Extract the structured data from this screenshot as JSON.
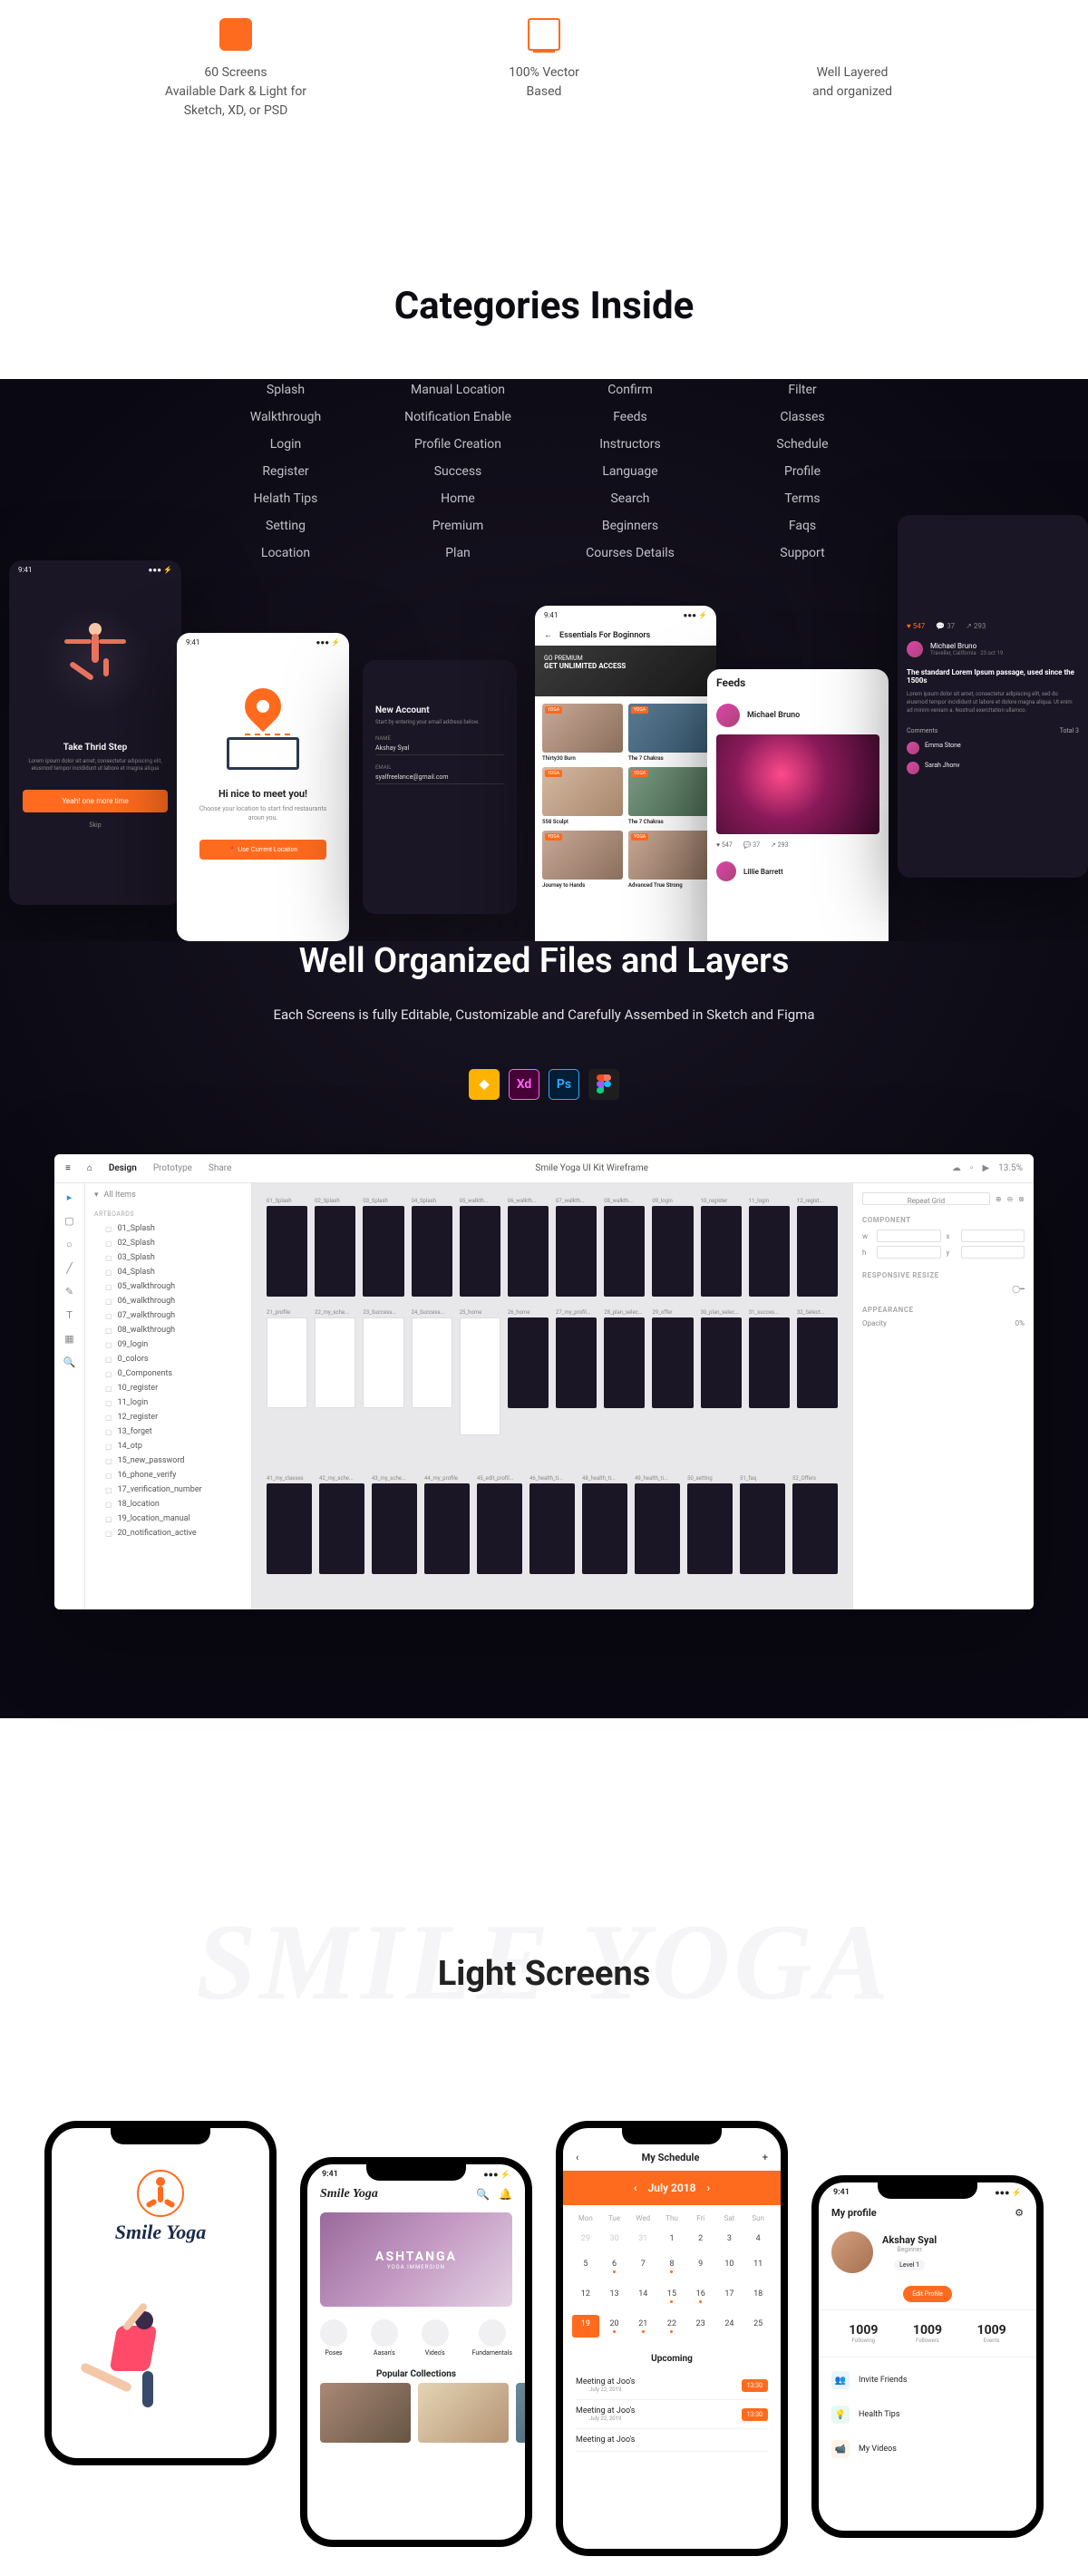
{
  "features": [
    {
      "title": "60 Screens\nAvailable Dark & Light for\nSketch, XD, or PSD"
    },
    {
      "title": "100% Vector\nBased"
    },
    {
      "title": "Well Layered\nand organized"
    }
  ],
  "categories_title": "Categories Inside",
  "categories": [
    "Splash",
    "Manual Location",
    "Confirm",
    "Filter",
    "Walkthrough",
    "Notification Enable",
    "Feeds",
    "Classes",
    "Login",
    "Profile Creation",
    "Instructors",
    "Schedule",
    "Register",
    "Success",
    "Language",
    "Profile",
    "Helath Tips",
    "Home",
    "Search",
    "Terms",
    "Setting",
    "Premium",
    "Beginners",
    "Faqs",
    "Location",
    "Plan",
    "Courses Details",
    "Support"
  ],
  "phones": {
    "ph1_status_time": "9:41",
    "ph1_title": "Take Thrid Step",
    "ph1_desc": "Lorem ipsum dolor sit amet, consectetur adipiscing elit, eiusmod tempor incididunt ut labore et magna aliqua",
    "ph1_btn": "Yeah! one more time",
    "ph1_skip": "Skip",
    "ph2_status_time": "9:41",
    "ph2_title": "Hi nice to meet you!",
    "ph2_desc": "Choose your location to start find restaurants aroun you.",
    "ph2_btn": "📍 Use Current Location",
    "ph3_title": "New Account",
    "ph3_desc": "Start by entering your email address below.",
    "ph3_field1_label": "NAME",
    "ph3_field1_val": "Akshay Syal",
    "ph3_field2_label": "EMAIL",
    "ph3_field2_val": "syalfreelance@gmail.com",
    "ph4_status_time": "9:41",
    "ph4_title": "Essentials For Boginnors",
    "ph4_hero1": "GO PREMIUM",
    "ph4_hero2": "GET UNLIMITED ACCESS",
    "ph4_cards": [
      "Thirty30 Burn",
      "The 7 Chakras",
      "558 Sculpt",
      "The 7 Chakras",
      "Journey to Hands",
      "Advanced True Strong"
    ],
    "ph5_title": "Feeds",
    "ph5_user": "Michael Bruno",
    "ph5_likes": "547",
    "ph5_comments": "37",
    "ph5_shares": "293",
    "ph5_user2": "Lillie Barrett",
    "ph6_likes": "547",
    "ph6_comments": "37",
    "ph6_shares": "293",
    "ph6_user": "Michael Bruno",
    "ph6_usersub": "Traveller, California · 23 oct 19",
    "ph6_headline": "The standard Lorem Ipsum passage, used since the 1500s",
    "ph6_lorem": "Lorem ipsum dolor sit amet, consectetur adipiscing elit, sed do eiusmod tempor incididunt ut labore et dolore magna aliqua. Ut enim ad minim veniam a. Nostrud exercitation ullamco.",
    "ph6_comments_label": "Comments",
    "ph6_total": "Total 3",
    "ph6_c1": "Emma Stone",
    "ph6_c2": "Sarah Jhonv"
  },
  "well_org": {
    "title": "Well Organized Files and Layers",
    "desc": "Each Screens is fully Editable, Customizable and Carefully Assembed in Sketch and Figma"
  },
  "design_tool": {
    "tabs": [
      "Design",
      "Prototype",
      "Share"
    ],
    "title": "Smile Yoga UI Kit Wireframe",
    "zoom": "13.5%",
    "layers_head": "All Items",
    "artboard_group": "ARTBOARDS",
    "layers": [
      "01_Splash",
      "02_Splash",
      "03_Splash",
      "04_Splash",
      "05_walkthrough",
      "06_walkthrough",
      "07_walkthrough",
      "08_walkthrough",
      "09_login",
      "0_colors",
      "0_Components",
      "10_register",
      "11_login",
      "12_register",
      "13_forget",
      "14_otp",
      "15_new_password",
      "16_phone_verify",
      "17_verification_number",
      "18_location",
      "19_location_manual",
      "20_notification_active"
    ],
    "canvas_labels_r1": [
      "01_Splash",
      "02_Splash",
      "03_Splash",
      "04_Splash",
      "05_walkth...",
      "06_walkth...",
      "07_walkth...",
      "08_walkth...",
      "09_login",
      "10_register",
      "11_login",
      "12_regist..."
    ],
    "canvas_labels_r2": [
      "21_profile",
      "22_my_sche...",
      "23_Success...",
      "24_Success...",
      "25_home",
      "26_home",
      "27_my_profil...",
      "28_plan_selec...",
      "29_offer",
      "30_plan_selec...",
      "31_succes...",
      "32_Select..."
    ],
    "canvas_labels_r3": [
      "41_my_classes",
      "42_my_sche...",
      "43_my_sche...",
      "44_my_profile",
      "45_edit_profil...",
      "46_health_ti...",
      "48_health_ti...",
      "49_health_ti...",
      "50_setting",
      "51_faq",
      "52_Offers"
    ],
    "panel_component": "COMPONENT",
    "panel_responsive": "RESPONSIVE RESIZE",
    "panel_appearance": "APPEARANCE",
    "repeat_grid": "Repeat Grid",
    "opacity": "0%"
  },
  "light_section": {
    "ghost": "SMILE YOGA",
    "title": "Light Screens"
  },
  "device1": {
    "brand": "Smile Yoga"
  },
  "device2": {
    "time": "9:41",
    "brand": "Smile Yoga",
    "hero_title": "ASHTANGA",
    "hero_sub": "YOGA IMMERSION",
    "pills": [
      "Poses",
      "Aasan's",
      "Video's",
      "Fundamentals"
    ],
    "sec_title": "Popular Collections"
  },
  "device3": {
    "head": "My Schedule",
    "month": "July 2018",
    "weekdays": [
      "Mon",
      "Tue",
      "Wed",
      "Thu",
      "Fri",
      "Sat",
      "Sun"
    ],
    "days": [
      [
        29,
        30,
        31,
        1,
        2,
        3,
        4
      ],
      [
        5,
        6,
        7,
        8,
        9,
        10,
        11
      ],
      [
        12,
        13,
        14,
        15,
        16,
        17,
        18
      ],
      [
        19,
        20,
        21,
        22,
        23,
        24,
        25
      ]
    ],
    "upcoming": "Upcoming",
    "events": [
      {
        "title": "Meeting at Joo's",
        "sub": "July 22, 2019",
        "time": "13:30"
      },
      {
        "title": "Meeting at Joo's",
        "sub": "July 22, 2019",
        "time": "13:30"
      },
      {
        "title": "Meeting at Joo's",
        "sub": "",
        "time": ""
      }
    ]
  },
  "device4": {
    "time": "9:41",
    "head": "My profile",
    "name": "Akshay Syal",
    "role": "Beginner",
    "level": "Level 1",
    "edit": "Edit Profile",
    "stats": [
      {
        "n": "1009",
        "l": "Following"
      },
      {
        "n": "1009",
        "l": "Followers"
      },
      {
        "n": "1009",
        "l": "Events"
      }
    ],
    "menu": [
      "Invite Friends",
      "Health Tips",
      "My Videos"
    ]
  }
}
